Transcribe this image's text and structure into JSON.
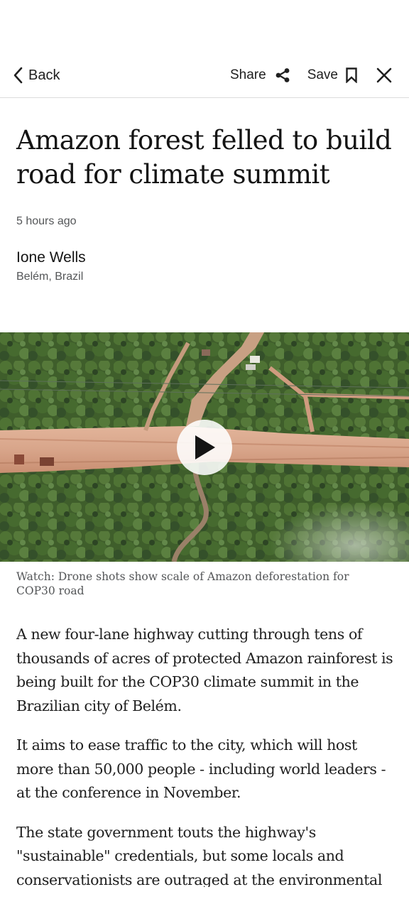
{
  "toolbar": {
    "back_label": "Back",
    "share_label": "Share",
    "save_label": "Save",
    "icons": [
      "back-chevron-icon",
      "share-icon",
      "bookmark-icon",
      "close-icon"
    ]
  },
  "article": {
    "headline": "Amazon forest felled to build road for climate summit",
    "timestamp": "5 hours ago",
    "author": "Ione Wells",
    "location": "Belém, Brazil",
    "video_caption": "Watch: Drone shots show scale of Amazon deforestation for COP30 road",
    "paragraphs": [
      "A new four-lane highway cutting through tens of thousands of acres of protected Amazon rainforest is being built for the COP30 climate summit in the Brazilian city of Belém.",
      "It aims to ease traffic to the city, which will host more than 50,000 people - including world leaders - at the conference in November.",
      "The state government touts the highway's \"sustainable\" credentials, but some locals and conservationists are outraged at the environmental"
    ]
  },
  "colors": {
    "text_primary": "#141414",
    "text_secondary": "#545658",
    "divider": "#dcdcdc",
    "forest_green": "#3e5a2a",
    "road_clay": "#d9a88c"
  }
}
